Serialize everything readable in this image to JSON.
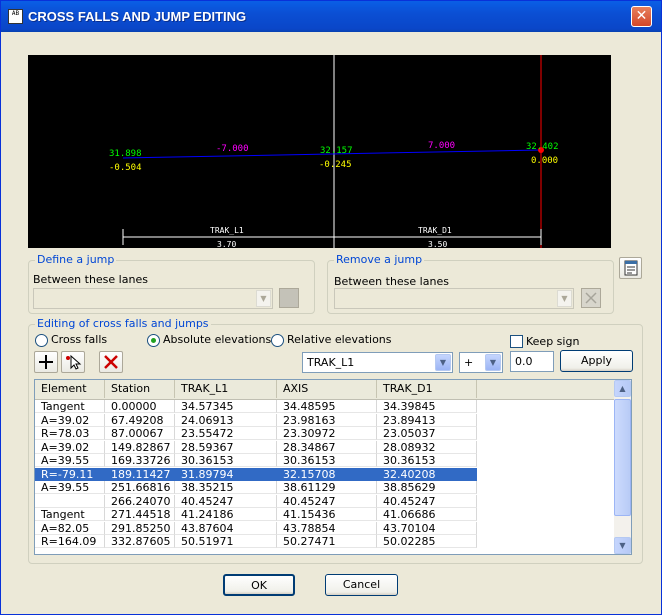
{
  "window": {
    "title": "CROSS FALLS AND JUMP EDITING",
    "app_icon_text": "AB",
    "close_symbol": "✕"
  },
  "preview": {
    "left_label": "TRAK_L1",
    "right_label": "TRAK_D1",
    "left_width": "3.70",
    "right_width": "3.50",
    "left_elev": "31.898",
    "left_fall": "-0.504",
    "left_slope": "-7.000",
    "axis_elev": "32.157",
    "axis_fall": "-0.245",
    "right_slope": "7.000",
    "right_elev": "32.402",
    "right_fall": "0.000",
    "colors": {
      "elevation": "#00ff00",
      "fall": "#ffff00",
      "slope": "#ff00ff",
      "baseline": "#0000ff",
      "axis": "#ffffff",
      "cursor": "#ff0000"
    }
  },
  "define_jump": {
    "legend": "Define a jump",
    "between_label": "Between these lanes"
  },
  "remove_jump": {
    "legend": "Remove a jump",
    "between_label": "Between these lanes"
  },
  "editing": {
    "legend": "Editing of cross falls and jumps",
    "mode_cross_falls": "Cross falls",
    "mode_absolute": "Absolute elevations",
    "mode_relative": "Relative elevations",
    "selected_mode": "absolute",
    "keep_sign_label": "Keep sign",
    "keep_sign_checked": false,
    "lane_select": "TRAK_L1",
    "sign_select": "+",
    "value_input": "0.0",
    "apply_label": "Apply",
    "tool_icons": [
      "add-icon",
      "pointer-edit-icon",
      "delete-icon"
    ]
  },
  "table": {
    "columns": [
      "Element",
      "Station",
      "TRAK_L1",
      "AXIS",
      "TRAK_D1"
    ],
    "rows": [
      [
        "Tangent",
        "0.00000",
        "34.57345",
        "34.48595",
        "34.39845"
      ],
      [
        "A=39.02",
        "67.49208",
        "24.06913",
        "23.98163",
        "23.89413"
      ],
      [
        "R=78.03",
        "87.00067",
        "23.55472",
        "23.30972",
        "23.05037"
      ],
      [
        "A=39.02",
        "149.82867",
        "28.59367",
        "28.34867",
        "28.08932"
      ],
      [
        "A=39.55",
        "169.33726",
        "30.36153",
        "30.36153",
        "30.36153"
      ],
      [
        "R=-79.11",
        "189.11427",
        "31.89794",
        "32.15708",
        "32.40208"
      ],
      [
        "A=39.55",
        "251.66816",
        "38.35215",
        "38.61129",
        "38.85629"
      ],
      [
        "",
        "266.24070",
        "40.45247",
        "40.45247",
        "40.45247"
      ],
      [
        "Tangent",
        "271.44518",
        "41.24186",
        "41.15436",
        "41.06686"
      ],
      [
        "A=82.05",
        "291.85250",
        "43.87604",
        "43.78854",
        "43.70104"
      ],
      [
        "R=164.09",
        "332.87605",
        "50.51971",
        "50.27471",
        "50.02285"
      ]
    ],
    "selected_row": 5
  },
  "footer": {
    "ok_label": "OK",
    "cancel_label": "Cancel"
  }
}
